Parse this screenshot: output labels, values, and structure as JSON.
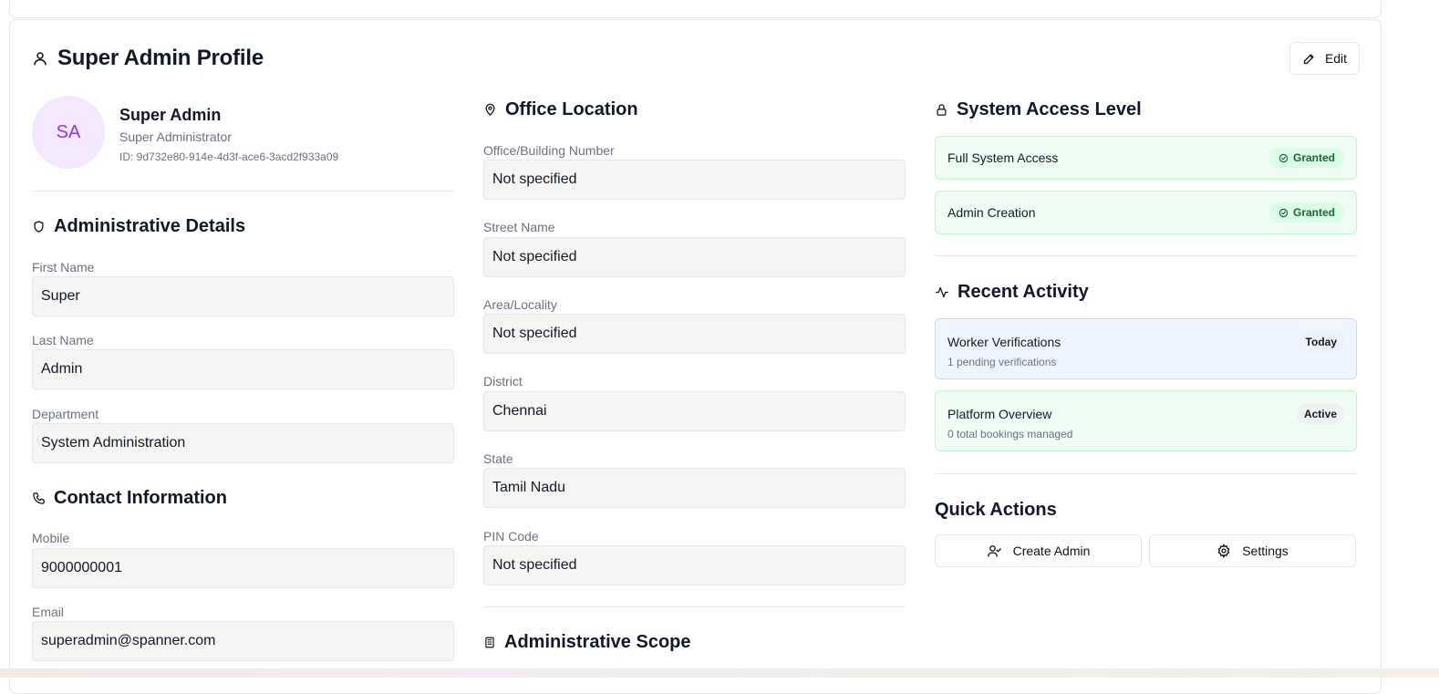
{
  "header": {
    "title": "Super Admin Profile",
    "edit_label": "Edit"
  },
  "profile": {
    "initials": "SA",
    "name": "Super Admin",
    "role": "Super Administrator",
    "id": "ID: 9d732e80-914e-4d3f-ace6-3acd2f933a09"
  },
  "admin_details": {
    "title": "Administrative Details",
    "fields": [
      {
        "label": "First Name",
        "value": "Super"
      },
      {
        "label": "Last Name",
        "value": "Admin"
      },
      {
        "label": "Department",
        "value": "System Administration"
      }
    ]
  },
  "contact": {
    "title": "Contact Information",
    "fields": [
      {
        "label": "Mobile",
        "value": "9000000001"
      },
      {
        "label": "Email",
        "value": "superadmin@spanner.com"
      }
    ]
  },
  "office": {
    "title": "Office Location",
    "fields": [
      {
        "label": "Office/Building Number",
        "value": "Not specified"
      },
      {
        "label": "Street Name",
        "value": "Not specified"
      },
      {
        "label": "Area/Locality",
        "value": "Not specified"
      },
      {
        "label": "District",
        "value": "Chennai"
      },
      {
        "label": "State",
        "value": "Tamil Nadu"
      },
      {
        "label": "PIN Code",
        "value": "Not specified"
      }
    ]
  },
  "scope": {
    "title": "Administrative Scope"
  },
  "access": {
    "title": "System Access Level",
    "items": [
      {
        "label": "Full System Access",
        "status": "Granted"
      },
      {
        "label": "Admin Creation",
        "status": "Granted"
      }
    ]
  },
  "activity": {
    "title": "Recent Activity",
    "items": [
      {
        "title": "Worker Verifications",
        "subtitle": "1 pending verifications",
        "badge": "Today"
      },
      {
        "title": "Platform Overview",
        "subtitle": "0 total bookings managed",
        "badge": "Active"
      }
    ]
  },
  "quick_actions": {
    "title": "Quick Actions",
    "create_admin_label": "Create Admin",
    "settings_label": "Settings"
  },
  "colors": {
    "avatar_bg": "#f3e8ff",
    "avatar_text": "#9333ea",
    "granted_bg": "#f0fdf4",
    "activity_blue_bg": "#eff6ff",
    "activity_green_bg": "#f0fdf4"
  },
  "icons": {
    "title": "user-icon",
    "edit": "pencil-icon",
    "admin_details": "shield-icon",
    "contact": "phone-icon",
    "office": "map-pin-icon",
    "scope": "building-icon",
    "access": "lock-icon",
    "activity": "activity-icon",
    "granted": "check-circle-icon",
    "create_admin": "user-plus-icon",
    "settings": "gear-icon"
  }
}
